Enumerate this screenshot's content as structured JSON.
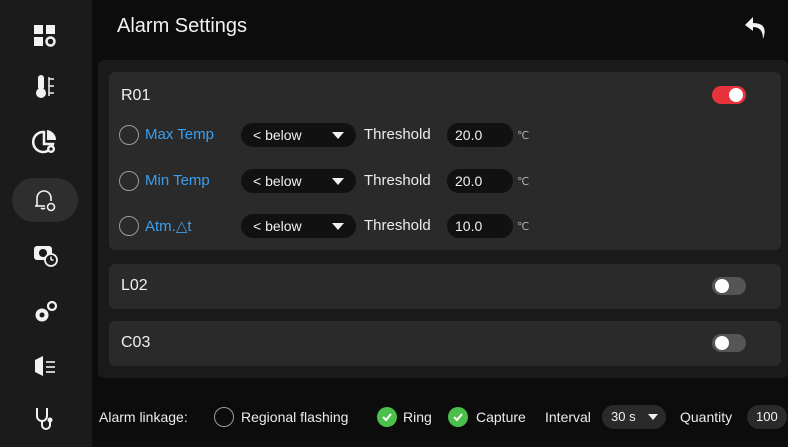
{
  "header": {
    "title": "Alarm Settings",
    "back_icon": "back-arrow-icon"
  },
  "sidebar": {
    "items": [
      {
        "icon": "grid-settings-icon",
        "active": false
      },
      {
        "icon": "thermometer-icon",
        "active": false
      },
      {
        "icon": "chart-settings-icon",
        "active": false
      },
      {
        "icon": "bell-settings-icon",
        "active": true
      },
      {
        "icon": "camera-timer-icon",
        "active": false
      },
      {
        "icon": "gears-icon",
        "active": false
      },
      {
        "icon": "network-icon",
        "active": false
      },
      {
        "icon": "stethoscope-icon",
        "active": false
      }
    ]
  },
  "regions": [
    {
      "name": "R01",
      "enabled": true,
      "rules": [
        {
          "label": "Max Temp",
          "condition": "< below",
          "threshold_label": "Threshold",
          "threshold": "20.0",
          "unit": "℃"
        },
        {
          "label": "Min Temp",
          "condition": "< below",
          "threshold_label": "Threshold",
          "threshold": "20.0",
          "unit": "℃"
        },
        {
          "label": "Atm.△t",
          "condition": "< below",
          "threshold_label": "Threshold",
          "threshold": "10.0",
          "unit": "℃"
        }
      ]
    },
    {
      "name": "L02",
      "enabled": false
    },
    {
      "name": "C03",
      "enabled": false
    }
  ],
  "footer": {
    "linkage_label": "Alarm linkage:",
    "regional_flashing": {
      "label": "Regional flashing",
      "checked": false
    },
    "ring": {
      "label": "Ring",
      "checked": true
    },
    "capture": {
      "label": "Capture",
      "checked": true
    },
    "interval_label": "Interval",
    "interval_value": "30 s",
    "quantity_label": "Quantity",
    "quantity_value": "100"
  },
  "colors": {
    "accent_blue": "#3a9ff0",
    "toggle_on": "#e8333c",
    "check_green": "#4cc04c"
  }
}
